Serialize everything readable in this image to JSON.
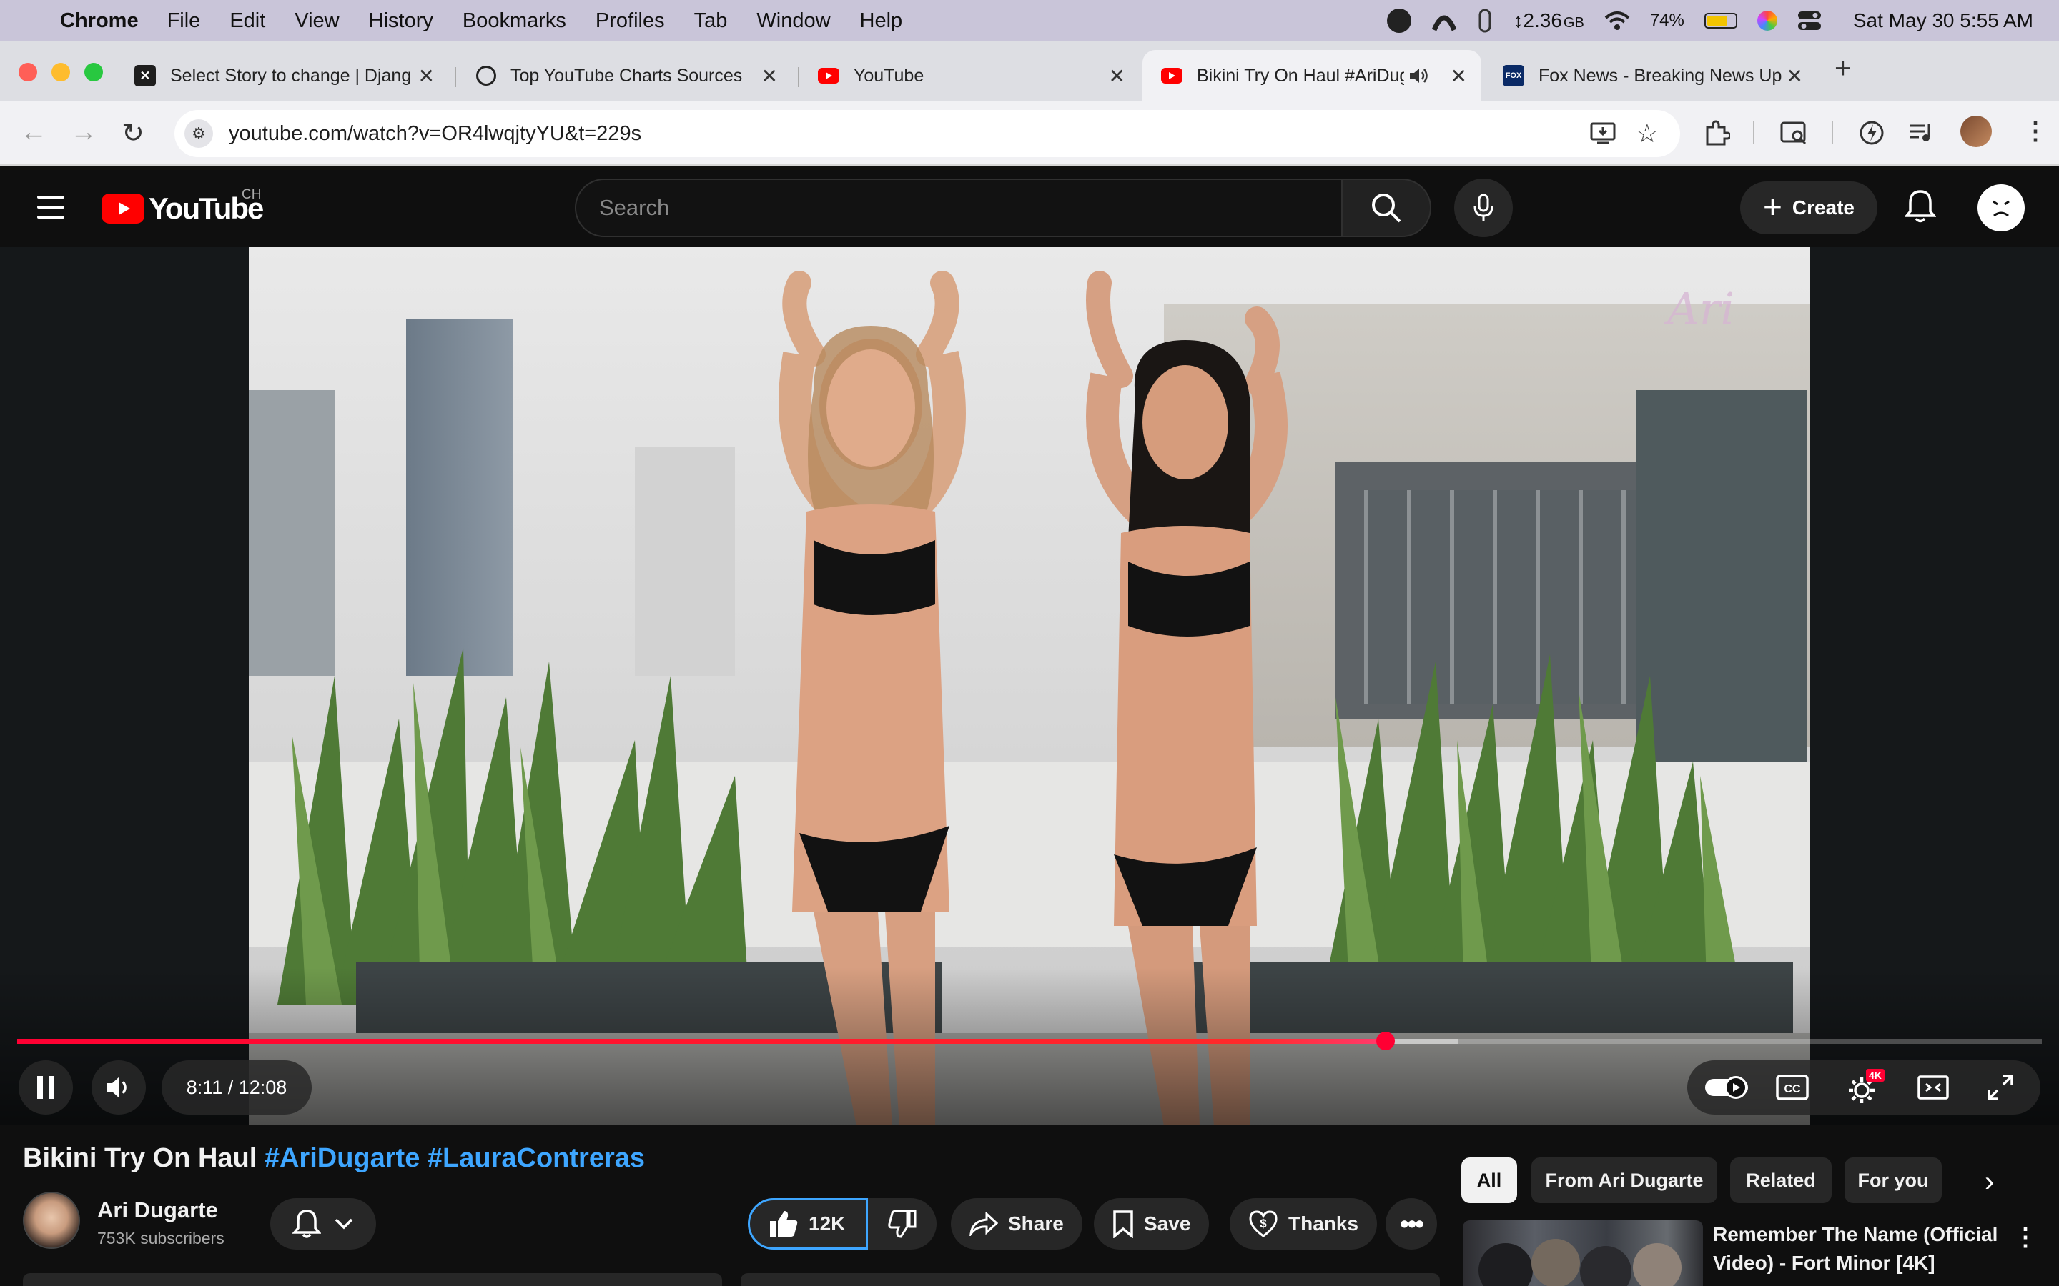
{
  "menubar": {
    "app_name": "Chrome",
    "items": [
      "File",
      "Edit",
      "View",
      "History",
      "Bookmarks",
      "Profiles",
      "Tab",
      "Window",
      "Help"
    ],
    "memory": "↕2.36",
    "memory_unit": "GB",
    "battery_percent": "74%",
    "battery_level": 0.74,
    "datetime": "Sat May 30  5:55 AM"
  },
  "tabs": [
    {
      "title": "Select Story to change | Djang",
      "favicon": "django-icon",
      "active": false
    },
    {
      "title": "Top YouTube Charts Sources",
      "favicon": "chatgpt-icon",
      "active": false
    },
    {
      "title": "YouTube",
      "favicon": "youtube-icon",
      "active": false
    },
    {
      "title": "Bikini Try On Haul #AriDuga",
      "favicon": "youtube-icon",
      "active": true,
      "audio": true
    },
    {
      "title": "Fox News - Breaking News Up",
      "favicon": "foxnews-icon",
      "active": false
    }
  ],
  "address": {
    "url": "youtube.com/watch?v=OR4lwqjtyYU&t=229s"
  },
  "youtube": {
    "logo_text": "YouTube",
    "country": "CH",
    "search_placeholder": "Search",
    "create_label": "Create"
  },
  "player": {
    "time": "8:11 / 12:08",
    "played_fraction": 0.676,
    "buffered_fraction": 0.712,
    "watermark": "Ari",
    "quality_badge": "4K"
  },
  "video": {
    "title_main": "Bikini Try On Haul ",
    "title_tags": "#AriDugarte #LauraContreras",
    "channel": "Ari Dugarte",
    "subscribers": "753K subscribers",
    "likes": "12K",
    "share_label": "Share",
    "save_label": "Save",
    "thanks_label": "Thanks"
  },
  "sidebar": {
    "chips": [
      "All",
      "From Ari Dugarte",
      "Related",
      "For you"
    ],
    "recommendation": {
      "title_line1": "Remember The Name (Official",
      "title_line2": "Video) - Fort Minor [4K]"
    }
  },
  "colors": {
    "youtube_red": "#ff0000",
    "link_blue": "#3ea6ff",
    "page_bg": "#0f0f0f"
  }
}
